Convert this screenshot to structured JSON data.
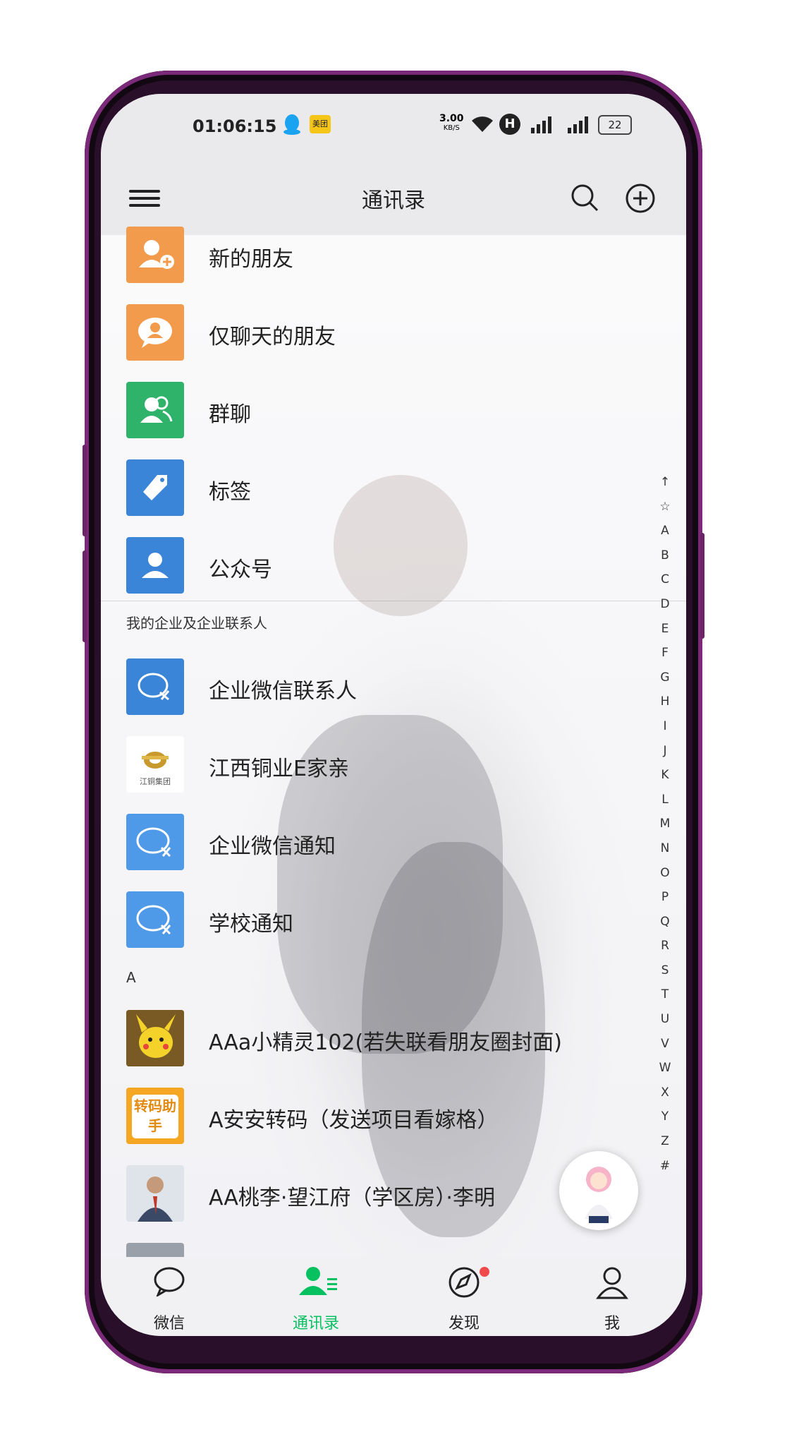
{
  "status_bar": {
    "time": "01:06:15",
    "net_speed": "3.00",
    "net_speed_unit": "KB/S",
    "hd_badge": "H",
    "battery": "22",
    "app_badge_meituan": "美团"
  },
  "header": {
    "title": "通讯录"
  },
  "top_entries": [
    {
      "label": "新的朋友",
      "icon": "add-friend-icon",
      "color": "#f29b4c"
    },
    {
      "label": "仅聊天的朋友",
      "icon": "chat-friend-icon",
      "color": "#f29b4c"
    },
    {
      "label": "群聊",
      "icon": "group-chat-icon",
      "color": "#2fb36a"
    },
    {
      "label": "标签",
      "icon": "tag-icon",
      "color": "#3b85d8"
    },
    {
      "label": "公众号",
      "icon": "official-account-icon",
      "color": "#3b85d8"
    }
  ],
  "enterprise_section": {
    "header": "我的企业及企业联系人",
    "items": [
      {
        "label": "企业微信联系人",
        "icon": "wecom-icon",
        "color": "#3b85d8"
      },
      {
        "label": "江西铜业E家亲",
        "icon": "jiangxi-copper-logo",
        "logo_text": "江铜集团"
      },
      {
        "label": "企业微信通知",
        "icon": "wecom-notify-icon",
        "color": "#4f9ae8"
      },
      {
        "label": "学校通知",
        "icon": "school-notify-icon",
        "color": "#4f9ae8"
      }
    ]
  },
  "contacts_section": {
    "header": "A",
    "items": [
      {
        "label": "AAa小精灵102(若失联看朋友圈封面)",
        "icon": "pikachu-avatar"
      },
      {
        "label": "A安安转码（发送项目看嫁格）",
        "icon": "transcode-avatar",
        "avatar_text": "转码助手"
      },
      {
        "label": "AA桃李·望江府（学区房）·李明",
        "icon": "person-avatar"
      }
    ]
  },
  "alphabet_index": [
    "↑",
    "☆",
    "A",
    "B",
    "C",
    "D",
    "E",
    "F",
    "G",
    "H",
    "I",
    "J",
    "K",
    "L",
    "M",
    "N",
    "O",
    "P",
    "Q",
    "R",
    "S",
    "T",
    "U",
    "V",
    "W",
    "X",
    "Y",
    "Z",
    "#"
  ],
  "tabs": [
    {
      "label": "微信",
      "icon": "chat-bubble-icon",
      "active": false
    },
    {
      "label": "通讯录",
      "icon": "contacts-icon",
      "active": true
    },
    {
      "label": "发现",
      "icon": "compass-icon",
      "active": false
    },
    {
      "label": "我",
      "icon": "person-icon",
      "active": false
    }
  ],
  "colors": {
    "active_tab": "#07c160",
    "text": "#222222",
    "badge": "#f04a4a"
  }
}
